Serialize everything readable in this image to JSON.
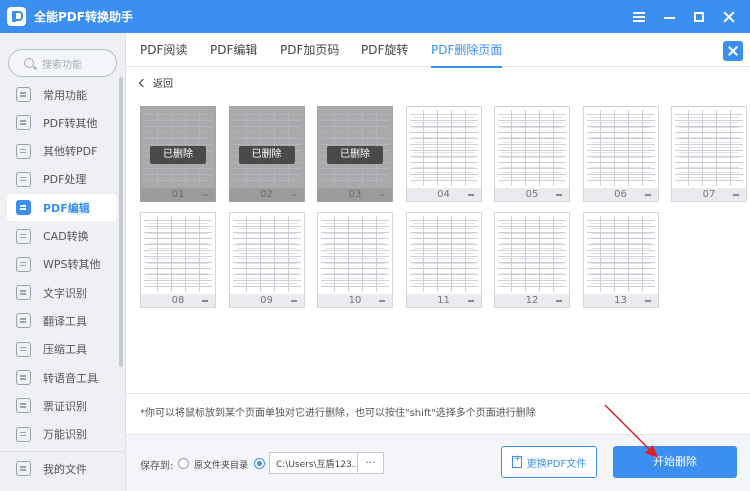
{
  "app": {
    "title": "全能PDF转换助手"
  },
  "sidebar": {
    "search_placeholder": "搜索功能",
    "items": [
      {
        "label": "常用功能",
        "active": false
      },
      {
        "label": "PDF转其他",
        "active": false
      },
      {
        "label": "其他转PDF",
        "active": false
      },
      {
        "label": "PDF处理",
        "active": false
      },
      {
        "label": "PDF编辑",
        "active": true
      },
      {
        "label": "CAD转换",
        "active": false
      },
      {
        "label": "WPS转其他",
        "active": false
      },
      {
        "label": "文字识别",
        "active": false
      },
      {
        "label": "翻译工具",
        "active": false
      },
      {
        "label": "压缩工具",
        "active": false
      },
      {
        "label": "转语音工具",
        "active": false
      },
      {
        "label": "票证识别",
        "active": false
      },
      {
        "label": "万能识别",
        "active": false
      }
    ],
    "my_files": "我的文件"
  },
  "tabs": [
    {
      "label": "PDF阅读",
      "active": false
    },
    {
      "label": "PDF编辑",
      "active": false
    },
    {
      "label": "PDF加页码",
      "active": false
    },
    {
      "label": "PDF旋转",
      "active": false
    },
    {
      "label": "PDF删除页面",
      "active": true
    }
  ],
  "back_label": "返回",
  "deleted_label": "已删除",
  "pages": [
    {
      "num": "01",
      "deleted": true
    },
    {
      "num": "02",
      "deleted": true
    },
    {
      "num": "03",
      "deleted": true
    },
    {
      "num": "04",
      "deleted": false
    },
    {
      "num": "05",
      "deleted": false
    },
    {
      "num": "06",
      "deleted": false
    },
    {
      "num": "07",
      "deleted": false
    },
    {
      "num": "08",
      "deleted": false
    },
    {
      "num": "09",
      "deleted": false
    },
    {
      "num": "10",
      "deleted": false
    },
    {
      "num": "11",
      "deleted": false
    },
    {
      "num": "12",
      "deleted": false
    },
    {
      "num": "13",
      "deleted": false
    }
  ],
  "tip": "*你可以将鼠标放到某个页面单独对它进行删除，也可以按住\"shift\"选择多个页面进行删除",
  "save": {
    "label": "保存到:",
    "option_original": "原文件夹目录",
    "path": "C:\\Users\\互盾123...",
    "more": "···"
  },
  "buttons": {
    "replace": "更换PDF文件",
    "start": "开始删除"
  },
  "colors": {
    "accent": "#3a8ff0",
    "annotation_arrow": "#e02020"
  }
}
